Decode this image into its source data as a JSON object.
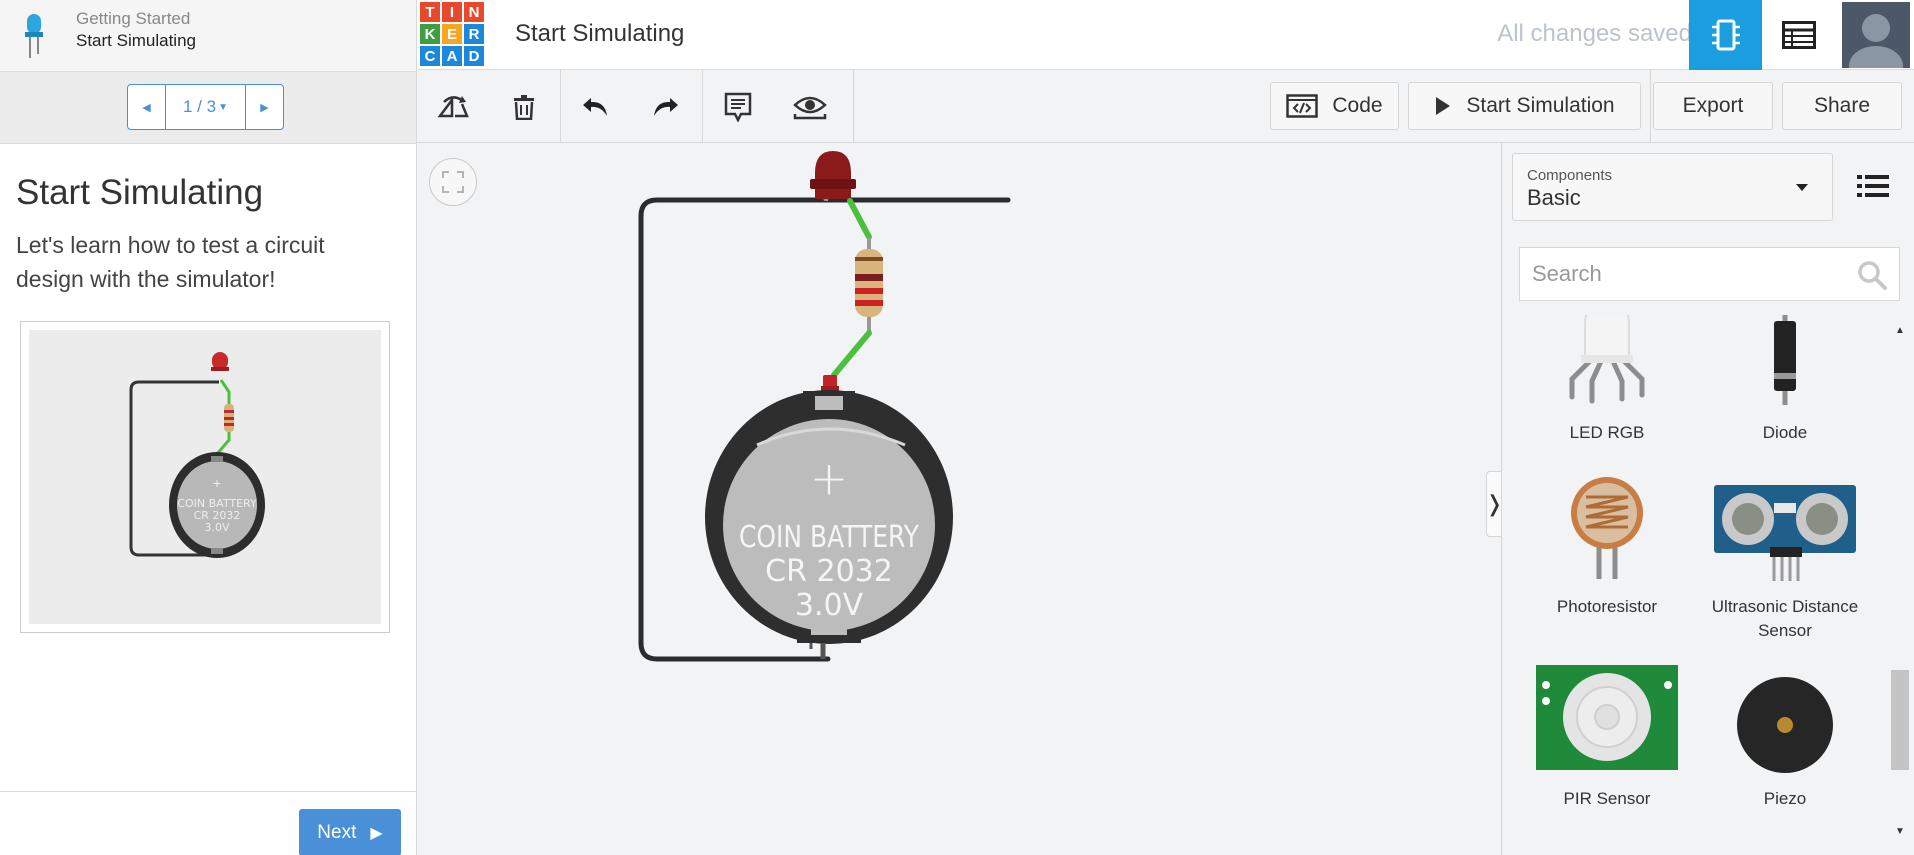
{
  "lesson": {
    "crumb": "Getting Started",
    "name": "Start Simulating",
    "page_indicator": "1 / 3",
    "title": "Start Simulating",
    "description": "Let's learn how to test a circuit design with the simulator!",
    "preview_battery_text": [
      "COIN BATTERY",
      "CR 2032",
      "3.0V"
    ],
    "next_label": "Next"
  },
  "topbar": {
    "logo_letters": [
      "T",
      "I",
      "N",
      "K",
      "E",
      "R",
      "C",
      "A",
      "D"
    ],
    "logo_colors": [
      "#e8492d",
      "#e8492d",
      "#e8492d",
      "#3f9d43",
      "#f6a623",
      "#1e88d8",
      "#1e88d8",
      "#1e88d8",
      "#1e88d8"
    ],
    "design_title": "Start Simulating",
    "save_status": "All changes saved"
  },
  "toolbar": {
    "code_label": "Code",
    "start_simulation_label": "Start Simulation",
    "export_label": "Export",
    "share_label": "Share"
  },
  "canvas": {
    "battery_text": [
      "COIN BATTERY",
      "CR 2032",
      "3.0V"
    ]
  },
  "components": {
    "label": "Components",
    "selected": "Basic",
    "search_placeholder": "Search",
    "items": [
      {
        "name": "LED RGB",
        "icon": "led-rgb-icon"
      },
      {
        "name": "Diode",
        "icon": "diode-icon"
      },
      {
        "name": "Photoresistor",
        "icon": "photoresistor-icon"
      },
      {
        "name": "Ultrasonic Distance Sensor",
        "icon": "ultrasonic-sensor-icon"
      },
      {
        "name": "PIR Sensor",
        "icon": "pir-sensor-icon"
      },
      {
        "name": "Piezo",
        "icon": "piezo-icon"
      }
    ]
  },
  "colors": {
    "accent": "#1a9ee0",
    "next_button": "#4a90d9",
    "wire_green": "#4bbf3e",
    "led_red": "#b81d1d"
  }
}
